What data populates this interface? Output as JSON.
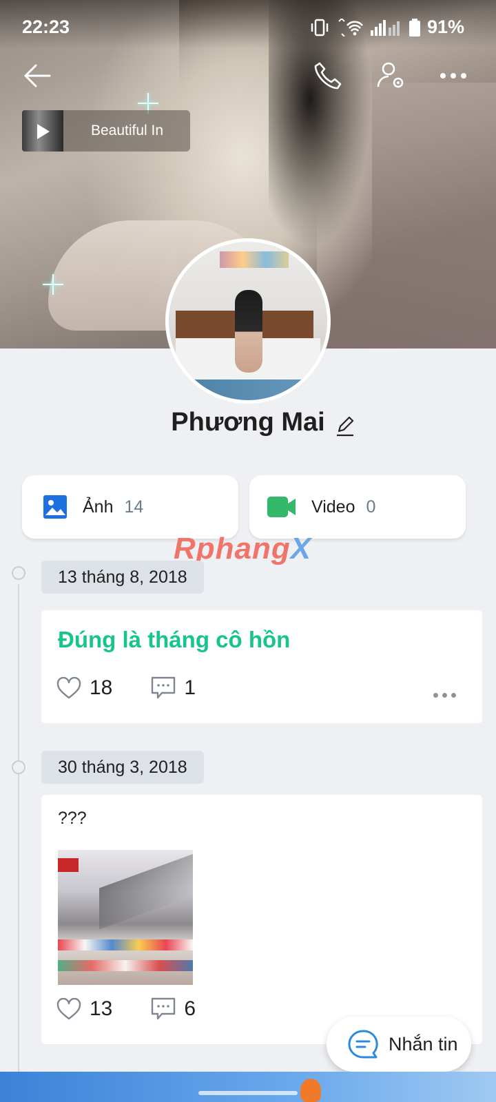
{
  "status_bar": {
    "time": "22:23",
    "battery": "91%"
  },
  "nav": {
    "back": "back-arrow-icon",
    "call": "phone-icon",
    "settings": "user-settings-icon",
    "more": "more-icon"
  },
  "music": {
    "title": "Beautiful In"
  },
  "profile": {
    "name": "Phương Mai"
  },
  "stats": {
    "photos": {
      "label": "Ảnh",
      "count": "14"
    },
    "videos": {
      "label": "Video",
      "count": "0"
    }
  },
  "watermark": {
    "main": "Rphang",
    "tail": "X"
  },
  "posts": [
    {
      "date": "13 tháng 8, 2018",
      "title": "Đúng là tháng cô hồn",
      "likes": "18",
      "comments": "1"
    },
    {
      "date": "30 tháng 3, 2018",
      "text": "???",
      "likes": "13",
      "comments": "6"
    }
  ],
  "chat_button": {
    "label": "Nhắn tin"
  },
  "colors": {
    "accent_green": "#18c48e",
    "photo_blue": "#1e6fe0",
    "video_green": "#33b86a",
    "chat_blue": "#2a8ae0"
  }
}
